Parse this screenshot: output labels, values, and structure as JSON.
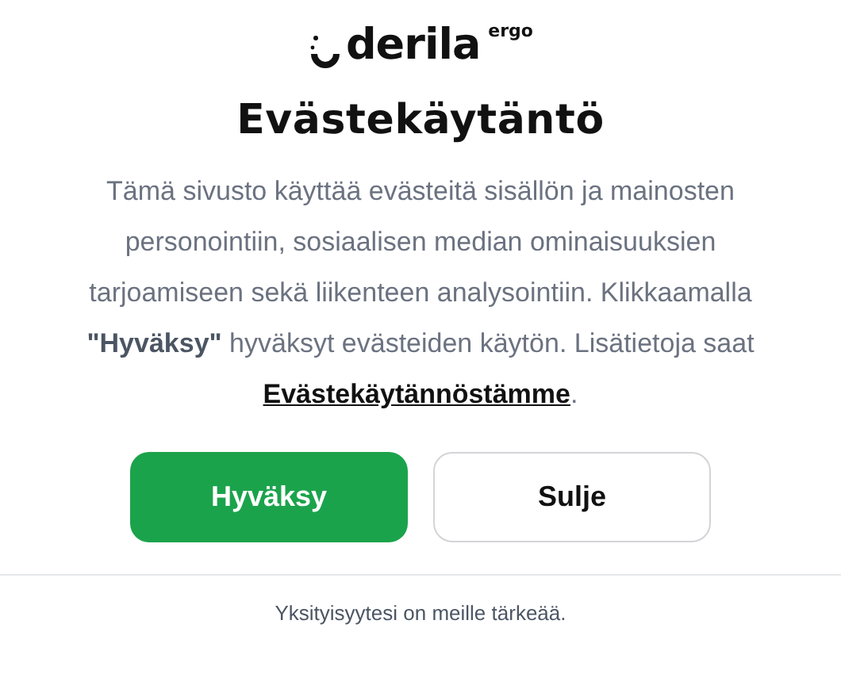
{
  "logo": {
    "wordmark": "derila",
    "superscript": "ergo"
  },
  "title": "Evästekäytäntö",
  "body": {
    "text": "Tämä sivusto käyttää evästeitä sisällön ja mainosten personointiin, sosiaalisen median ominaisuuksien tarjoamiseen sekä liikenteen analysointiin. Klikkaamalla **\"Hyväksy\"** hyväksyt evästeiden käytön. Lisätietoja saat",
    "link": "Evästekäytännöstämme",
    "after": "."
  },
  "buttons": [
    {
      "label": "Hyväksy",
      "kind": "primary"
    },
    {
      "label": "Sulje",
      "kind": "secondary"
    }
  ],
  "footer": "Yksityisyytesi on meille tärkeää."
}
